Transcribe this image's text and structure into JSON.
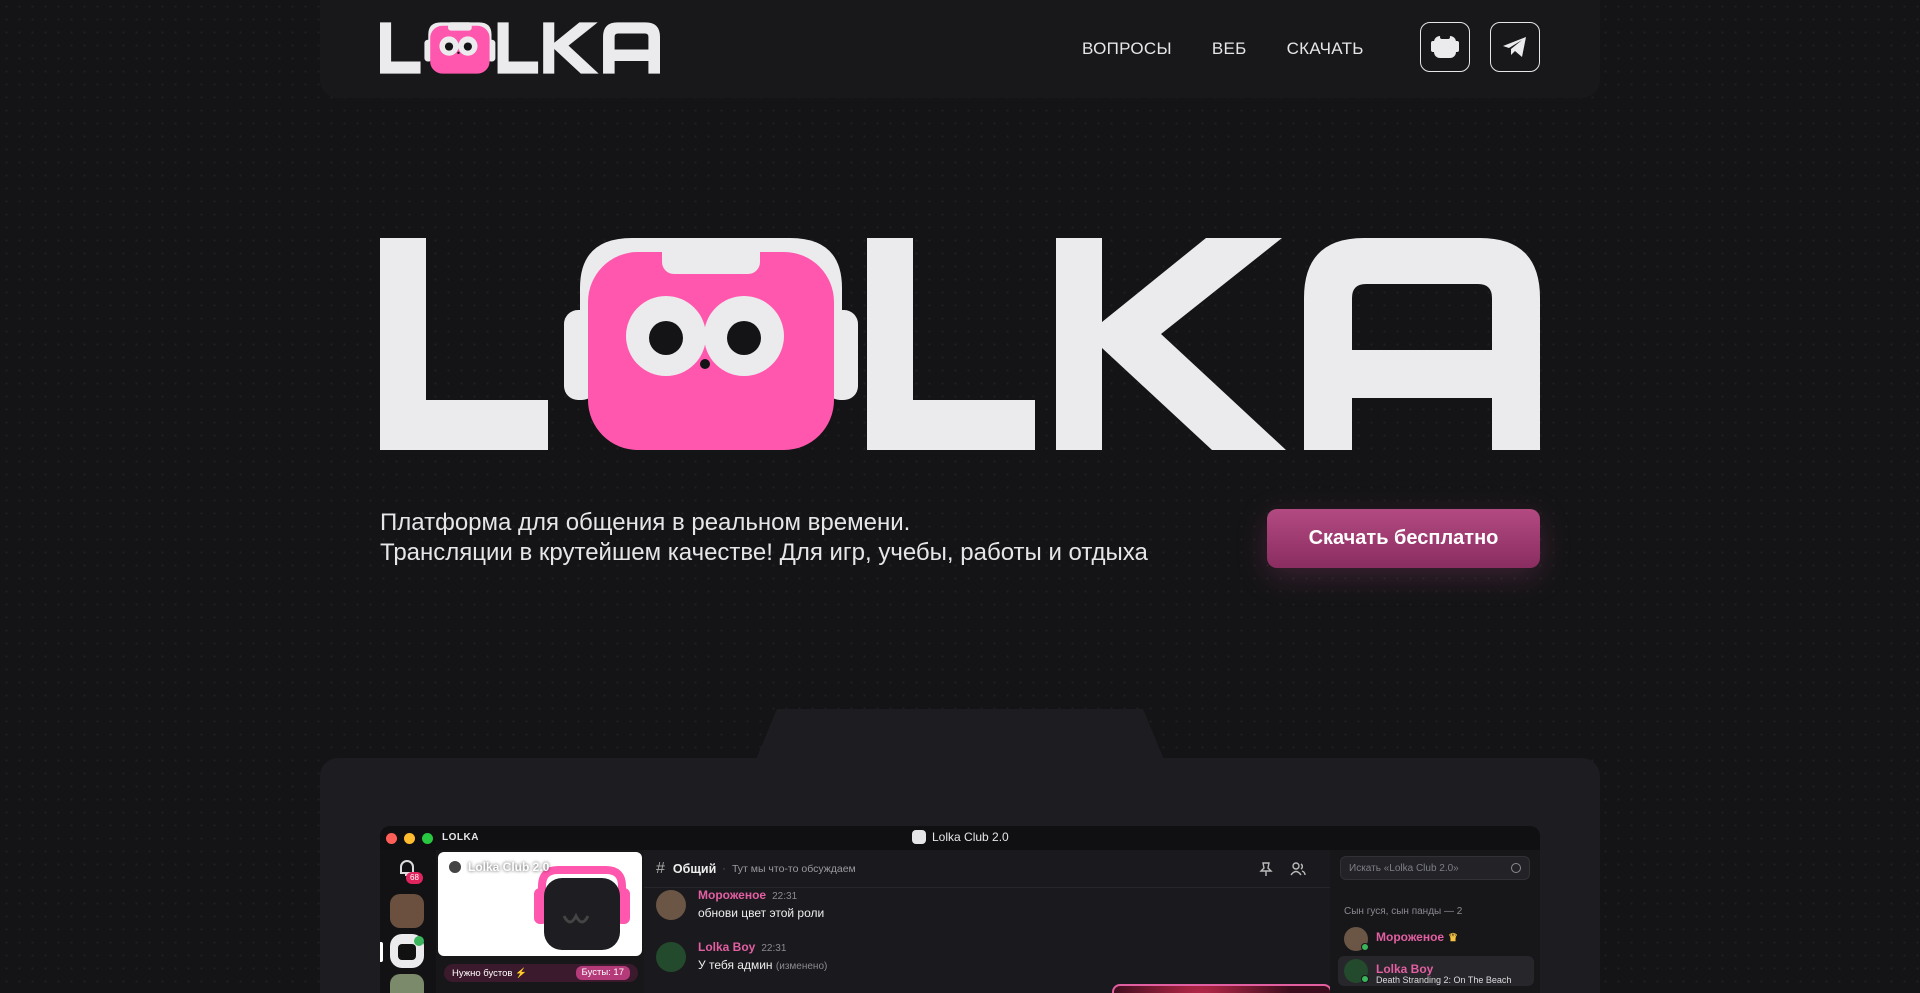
{
  "brand": {
    "name": "LOLKA",
    "pink": "#ff57ad",
    "white": "#ebebed"
  },
  "nav": {
    "links": [
      "ВОПРОСЫ",
      "ВЕБ",
      "СКАЧАТЬ"
    ],
    "buttons": [
      {
        "icon": "lolka-app-icon"
      },
      {
        "icon": "telegram-icon"
      }
    ]
  },
  "hero": {
    "tagline_line1": "Платформа для общения в реальном времени.",
    "tagline_line2": "Трансляции в крутейшем качестве! Для игр, учебы, работы и отдыха",
    "cta_label": "Скачать бесплатно",
    "cta_color": "#a8407a"
  },
  "app": {
    "titlebar_brand": "LOLKA",
    "window_title": "Lolka Club 2.0",
    "notification_count": "68",
    "server_name": "Lolka Club 2.0",
    "boost_label": "Нужно бустов ⚡",
    "boost_count": "Бусты: 17",
    "channel_name": "Общий",
    "channel_topic": "Тут мы что-то обсуждаем",
    "search_placeholder": "Искать «Lolka Club 2.0»",
    "messages": [
      {
        "author": "Мороженое",
        "time": "22:31",
        "text": "обнови цвет этой роли",
        "edited": ""
      },
      {
        "author": "Lolka Boy",
        "time": "22:31",
        "text": "У тебя админ",
        "edited": "(изменено)"
      }
    ],
    "member_group": "Сын гуся, сын панды — 2",
    "members": [
      {
        "name": "Мороженое",
        "crown": "♛",
        "activity": ""
      },
      {
        "name": "Lolka Boy",
        "crown": "",
        "activity": "Death Stranding 2: On The Beach"
      }
    ]
  }
}
